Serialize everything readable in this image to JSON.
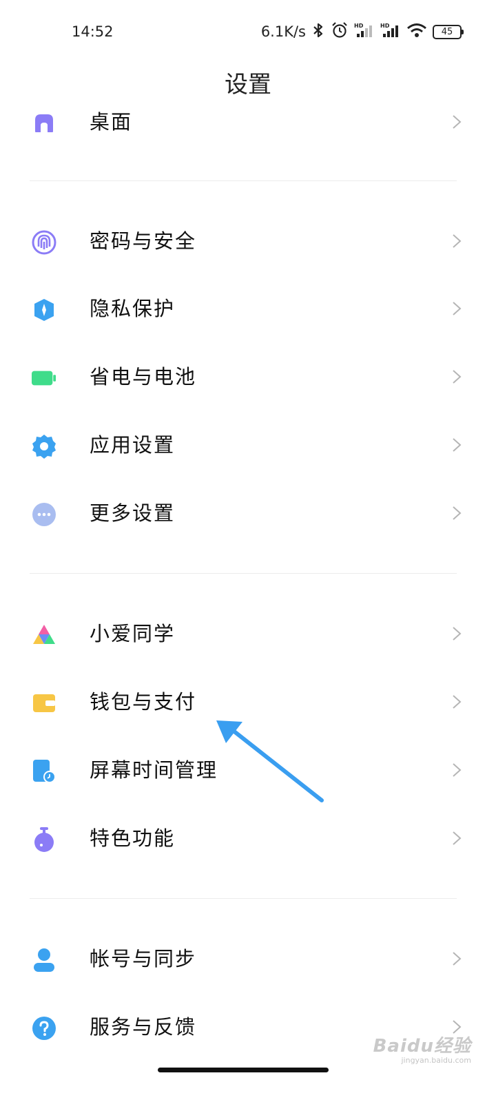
{
  "status_bar": {
    "time": "14:52",
    "net_speed": "6.1K/s",
    "battery_level": "45",
    "icons": [
      "bluetooth-icon",
      "alarm-icon",
      "hd-signal-icon",
      "hd-signal-icon",
      "wifi-icon",
      "battery-icon"
    ]
  },
  "header": {
    "title": "设置"
  },
  "items": [
    {
      "label": "桌面",
      "icon": "home-icon"
    },
    {
      "label": "密码与安全",
      "icon": "fingerprint-icon"
    },
    {
      "label": "隐私保护",
      "icon": "privacy-shield-icon"
    },
    {
      "label": "省电与电池",
      "icon": "battery-icon"
    },
    {
      "label": "应用设置",
      "icon": "gear-icon"
    },
    {
      "label": "更多设置",
      "icon": "more-icon"
    },
    {
      "label": "小爱同学",
      "icon": "xiaoai-icon"
    },
    {
      "label": "钱包与支付",
      "icon": "wallet-icon"
    },
    {
      "label": "屏幕时间管理",
      "icon": "screen-time-icon"
    },
    {
      "label": "特色功能",
      "icon": "feature-icon"
    },
    {
      "label": "帐号与同步",
      "icon": "account-icon"
    },
    {
      "label": "服务与反馈",
      "icon": "help-icon"
    }
  ],
  "colors": {
    "purple": "#8b7cf6",
    "blue": "#3ba2f0",
    "green": "#3fdc8a",
    "yellow": "#f7c645",
    "arrow": "#3a9ef0"
  },
  "watermark": {
    "main": "Baidu经验",
    "sub": "jingyan.baidu.com"
  }
}
